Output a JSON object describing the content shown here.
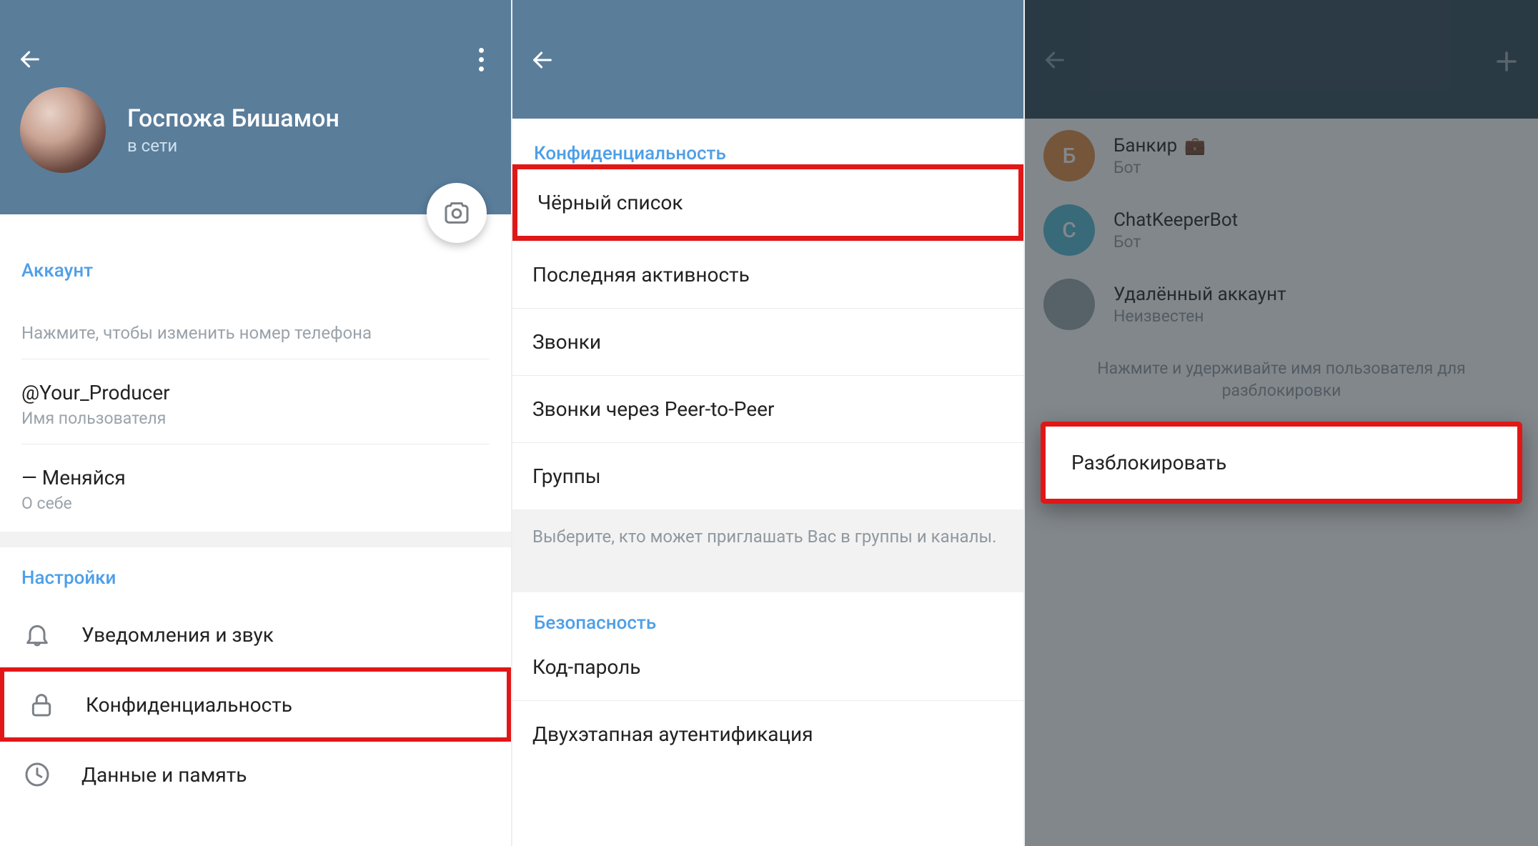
{
  "panel1": {
    "profile_name": "Госпожа Бишамон",
    "status": "в сети",
    "account_section": "Аккаунт",
    "phone_hint": "Нажмите, чтобы изменить номер телефона",
    "username": "@Your_Producer",
    "username_sub": "Имя пользователя",
    "bio": "— Меняйся",
    "bio_sub": "О себе",
    "settings_section": "Настройки",
    "menu": {
      "notifications": "Уведомления и звук",
      "privacy": "Конфиденциальность",
      "data": "Данные и память"
    }
  },
  "panel2": {
    "privacy_section": "Конфиденциальность",
    "items": {
      "blocklist": "Чёрный список",
      "last_seen": "Последняя активность",
      "calls": "Звонки",
      "p2p_calls": "Звонки через Peer-to-Peer",
      "groups": "Группы"
    },
    "groups_hint": "Выберите, кто может приглашать Вас в группы и каналы.",
    "security_section": "Безопасность",
    "sec_items": {
      "passcode": "Код-пароль",
      "two_step": "Двухэтапная аутентификация"
    }
  },
  "panel3": {
    "contacts": [
      {
        "initial": "Б",
        "name": "Банкир",
        "emoji": "💼",
        "sub": "Бот",
        "avatar": "orange"
      },
      {
        "initial": "С",
        "name": "ChatKeeperBot",
        "emoji": "",
        "sub": "Бот",
        "avatar": "cyan"
      },
      {
        "initial": "",
        "name": "Удалённый аккаунт",
        "emoji": "",
        "sub": "Неизвестен",
        "avatar": "gray"
      }
    ],
    "hold_hint": "Нажмите и удерживайте имя пользователя для разблокировки",
    "popup": {
      "unblock": "Разблокировать"
    }
  }
}
